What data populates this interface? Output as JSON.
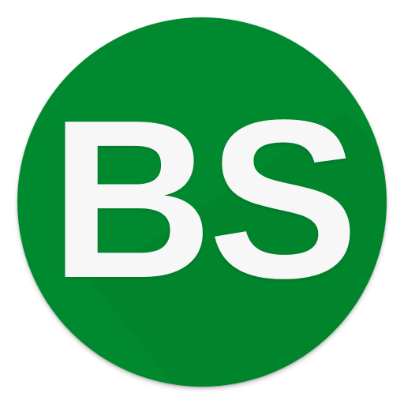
{
  "icon": {
    "name": "bs-app-icon",
    "monogram": "BS",
    "colors": {
      "circle": "#00892e",
      "circle_shade": "#007a28",
      "letters": "#f7f7f7",
      "background": "#ffffff"
    }
  }
}
